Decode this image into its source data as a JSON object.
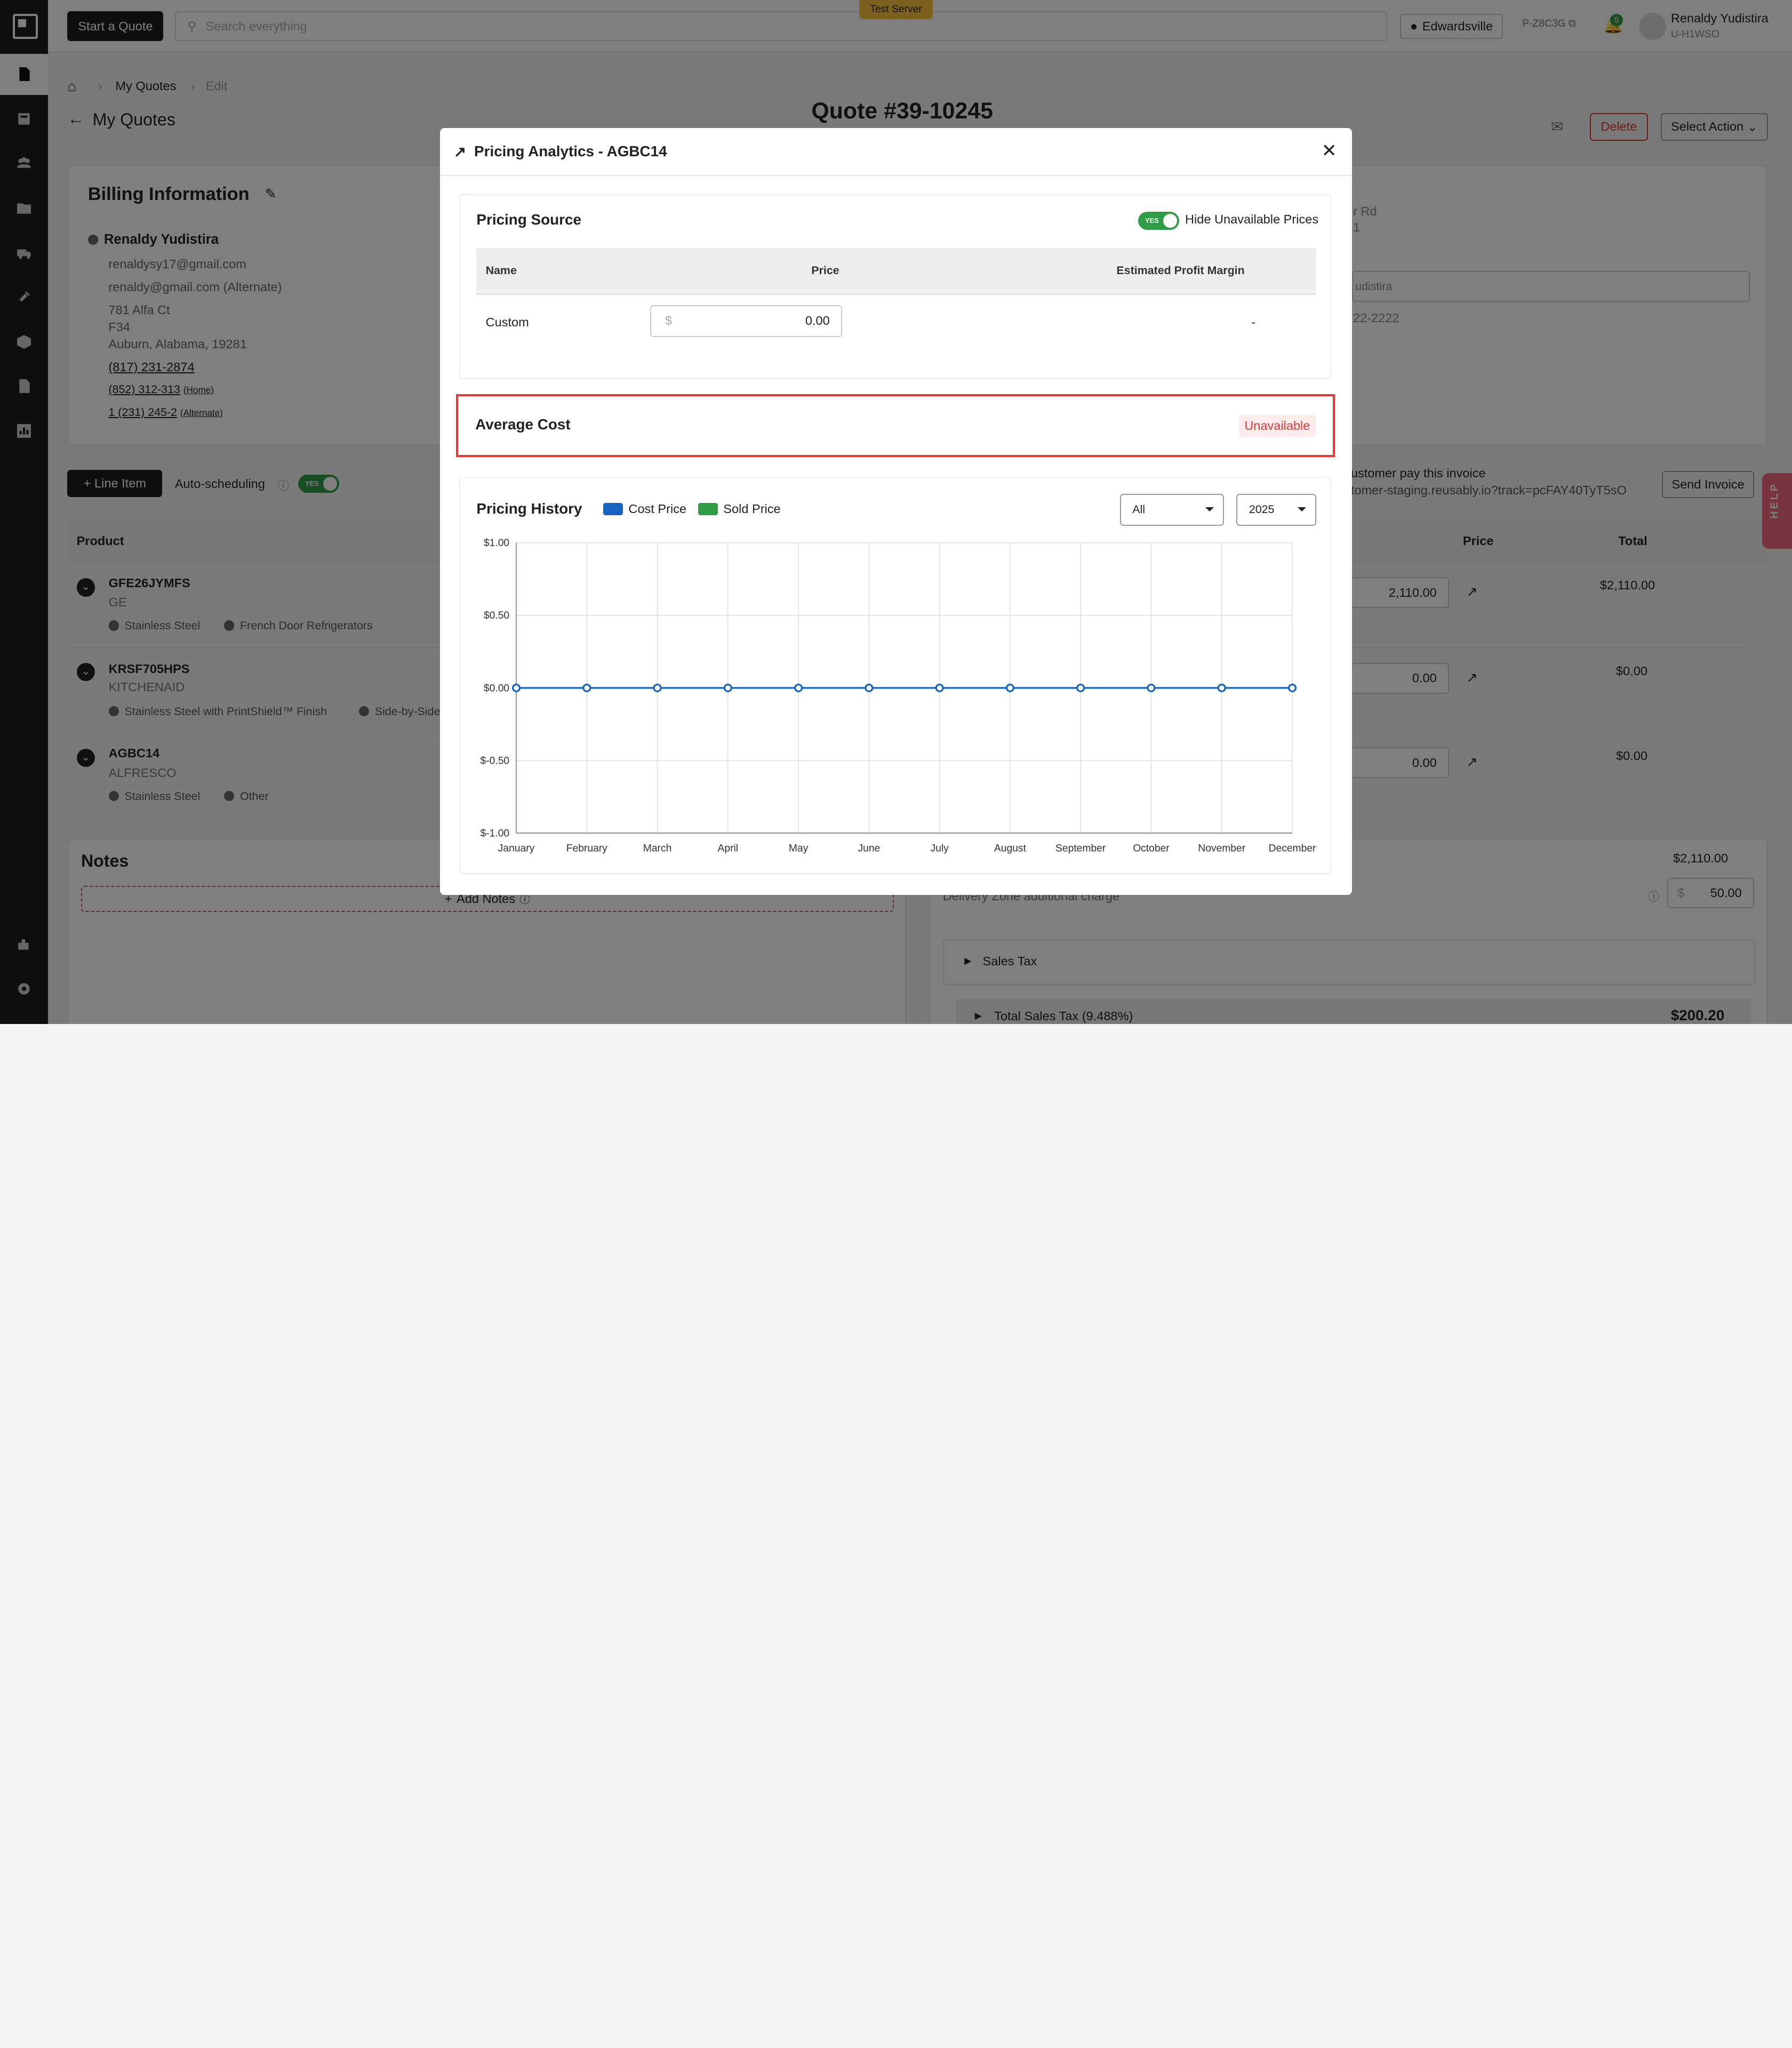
{
  "sidebar": {
    "items": [
      "quotes-icon",
      "invoices-icon",
      "customers-icon",
      "folders-icon",
      "delivery-truck-icon",
      "integrations-icon",
      "products-icon",
      "documents-icon",
      "reports-icon",
      "plugins-icon",
      "settings-icon"
    ]
  },
  "topbar": {
    "start_quote": "Start a Quote",
    "search_placeholder": "Search everything",
    "test_server": "Test Server",
    "location": "Edwardsville",
    "store_code": "P-Z8C3G",
    "notif_count": "5",
    "user_name": "Renaldy Yudistira",
    "user_code": "U-H1WSO"
  },
  "breadcrumb": {
    "my_quotes": "My Quotes",
    "edit": "Edit"
  },
  "page": {
    "back_label": "My Quotes",
    "quote_title": "Quote #39-10245",
    "delete": "Delete",
    "select_action": "Select Action"
  },
  "billing": {
    "title": "Billing Information",
    "name": "Renaldy Yudistira",
    "email": "renaldysy17@gmail.com",
    "email_alt": "renaldy@gmail.com (Alternate)",
    "addr1": "781 Alfa Ct",
    "addr2": "F34",
    "addr3": "Auburn, Alabama, 19281",
    "phone1": "(817) 231-2874",
    "phone2": "(852) 312-313",
    "phone2_tag": "(Home)",
    "phone3": "1 (231) 245-2",
    "phone3_tag": "(Alternate)"
  },
  "shipping_partial": {
    "addr_tail": "r Rd",
    "addr_tail2": "1",
    "select_tail": "udistira",
    "phone_tail": "22-2222"
  },
  "line_items": {
    "add_label": "Line Item",
    "auto_scheduling": "Auto-scheduling",
    "toggle_yes": "YES",
    "pay_text": "ustomer pay this invoice",
    "pay_link": "tomer-staging.reusably.io?track=pcFAY40TyT5sO",
    "send_invoice": "Send Invoice",
    "col_product": "Product",
    "col_price": "Price",
    "col_total": "Total",
    "rows": [
      {
        "sku": "GFE26JYMFS",
        "brand": "GE",
        "finish": "Stainless Steel",
        "category": "French Door Refrigerators",
        "price": "2,110.00",
        "total": "$2,110.00"
      },
      {
        "sku": "KRSF705HPS",
        "brand": "KITCHENAID",
        "finish": "Stainless Steel with PrintShield™ Finish",
        "category": "Side-by-Side",
        "price": "0.00",
        "total": "$0.00"
      },
      {
        "sku": "AGBC14",
        "brand": "ALFRESCO",
        "finish": "Stainless Steel",
        "category": "Other",
        "price": "0.00",
        "total": "$0.00"
      }
    ]
  },
  "notes": {
    "title": "Notes",
    "add_label": "Add Notes"
  },
  "summary": {
    "subtotal": "$2,110.00",
    "delivery_label": "Delivery Zone additional charge",
    "delivery_value": "50.00",
    "sales_tax": "Sales Tax",
    "total_tax_label": "Total Sales Tax (9.488%)",
    "total_tax_value": "$200.20"
  },
  "help": "HELP",
  "modal": {
    "title": "Pricing Analytics - AGBC14",
    "pricing_source": {
      "title": "Pricing Source",
      "toggle_yes": "YES",
      "hide_label": "Hide Unavailable Prices",
      "col_name": "Name",
      "col_price": "Price",
      "col_margin": "Estimated Profit Margin",
      "row_name": "Custom",
      "currency": "$",
      "row_price": "0.00",
      "row_margin": "-"
    },
    "average_cost": {
      "title": "Average Cost",
      "status": "Unavailable"
    },
    "history": {
      "title": "Pricing History",
      "legend_cost": "Cost Price",
      "legend_sold": "Sold Price",
      "filter_value": "All",
      "year_value": "2025"
    }
  },
  "colors": {
    "accent_dark": "#1f1f1f",
    "toggle_green": "#2e9d46",
    "cost_blue": "#1565c0",
    "sold_green": "#2e9d46",
    "danger_red": "#e53935"
  },
  "chart_data": {
    "type": "line",
    "categories": [
      "January",
      "February",
      "March",
      "April",
      "May",
      "June",
      "July",
      "August",
      "September",
      "October",
      "November",
      "December"
    ],
    "series": [
      {
        "name": "Cost Price",
        "values": [
          0,
          0,
          0,
          0,
          0,
          0,
          0,
          0,
          0,
          0,
          0,
          0
        ]
      }
    ],
    "ylim": [
      -1,
      1
    ],
    "yticks": [
      "$1.00",
      "$0.50",
      "$0.00",
      "$-0.50",
      "$-1.00"
    ],
    "ytick_values": [
      1,
      0.5,
      0,
      -0.5,
      -1
    ],
    "grid": true,
    "legend": "top-left"
  }
}
